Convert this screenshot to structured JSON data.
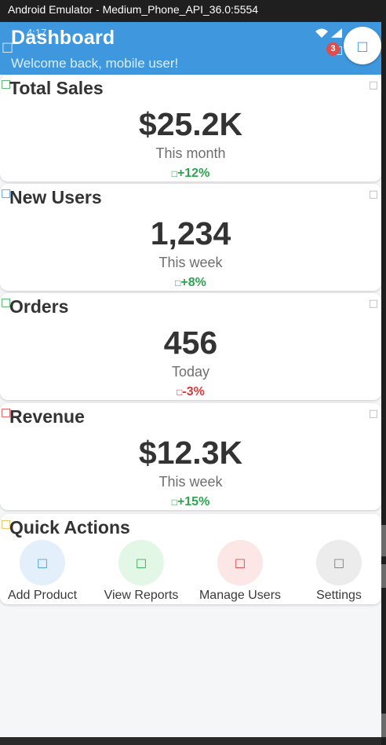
{
  "window": {
    "title": "Android Emulator - Medium_Phone_API_36.0:5554"
  },
  "status_bar": {
    "time": "4:17"
  },
  "header": {
    "title": "Dashboard",
    "subtitle": "Welcome back, mobile user!",
    "notification_count": "3",
    "background": "#3f97de"
  },
  "cards": [
    {
      "title": "Total Sales",
      "value": "$25.2K",
      "period": "This month",
      "change": "+12%",
      "trend": "up",
      "icon": "dollar-icon",
      "color": "#2ea44f",
      "icon_color": "#2ea44f"
    },
    {
      "title": "New Users",
      "value": "1,234",
      "period": "This week",
      "change": "+8%",
      "trend": "up",
      "icon": "users-icon",
      "color": "#2ea44f",
      "icon_color": "#3f97de"
    },
    {
      "title": "Orders",
      "value": "456",
      "period": "Today",
      "change": "-3%",
      "trend": "down",
      "icon": "cart-icon",
      "color": "#d9383a",
      "icon_color": "#2ea44f"
    },
    {
      "title": "Revenue",
      "value": "$12.3K",
      "period": "This week",
      "change": "+15%",
      "trend": "up",
      "icon": "chart-icon",
      "color": "#2ea44f",
      "icon_color": "#d9383a"
    }
  ],
  "quick_actions": {
    "title": "Quick Actions",
    "items": [
      {
        "label": "Add Product",
        "icon": "add-icon",
        "bg": "#e3f0fb",
        "fg": "#3f97de"
      },
      {
        "label": "View Reports",
        "icon": "reports-icon",
        "bg": "#e3f7e7",
        "fg": "#2ea44f"
      },
      {
        "label": "Manage Users",
        "icon": "users-icon",
        "bg": "#fde6e6",
        "fg": "#d9383a"
      },
      {
        "label": "Settings",
        "icon": "gear-icon",
        "bg": "#ececec",
        "fg": "#777777"
      }
    ]
  }
}
